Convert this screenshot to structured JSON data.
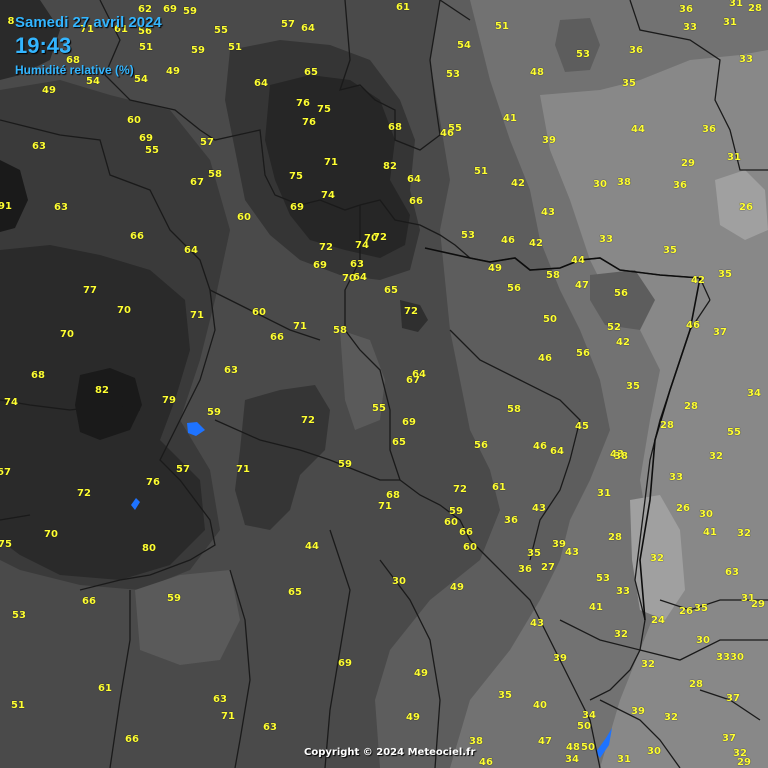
{
  "header": {
    "date": "Samedi 27 avril 2024",
    "time": "19:43",
    "variable": "Humidité relative (%)"
  },
  "copyright": "Copyright © 2024 Meteociel.fr",
  "colors": {
    "value_text": "#ffff33",
    "header_text": "#33b5ff",
    "water": "#1e73ff",
    "borders": "#1a1a1a"
  },
  "humidity_values": [
    "8",
    "62",
    "69",
    "59",
    "61",
    "71",
    "61",
    "56",
    "55",
    "57",
    "64",
    "54",
    "51",
    "36",
    "31",
    "28",
    "33",
    "31",
    "51",
    "59",
    "51",
    "49",
    "53",
    "36",
    "33",
    "68",
    "54",
    "54",
    "49",
    "53",
    "48",
    "65",
    "64",
    "76",
    "75",
    "35",
    "44",
    "60",
    "69",
    "76",
    "68",
    "41",
    "55",
    "46",
    "39",
    "36",
    "63",
    "55",
    "57",
    "82",
    "71",
    "31",
    "29",
    "58",
    "74",
    "64",
    "75",
    "67",
    "51",
    "42",
    "30",
    "38",
    "36",
    "91",
    "63",
    "69",
    "66",
    "26",
    "60",
    "53",
    "66",
    "72",
    "74",
    "70",
    "72",
    "43",
    "46",
    "42",
    "33",
    "35",
    "64",
    "63",
    "69",
    "70",
    "64",
    "44",
    "49",
    "58",
    "65",
    "47",
    "56",
    "42",
    "35",
    "77",
    "70",
    "63",
    "56",
    "60",
    "71",
    "72",
    "50",
    "52",
    "46",
    "37",
    "71",
    "66",
    "58",
    "42",
    "46",
    "70",
    "56",
    "68",
    "64",
    "67",
    "35",
    "82",
    "79",
    "74",
    "55",
    "69",
    "59",
    "58",
    "45",
    "28",
    "34",
    "72",
    "65",
    "56",
    "64",
    "46",
    "28",
    "55",
    "67",
    "71",
    "59",
    "43",
    "38",
    "32",
    "57",
    "76",
    "61",
    "72",
    "33",
    "68",
    "31",
    "72",
    "71",
    "59",
    "36",
    "43",
    "26",
    "30",
    "60",
    "66",
    "60",
    "39",
    "35",
    "43",
    "28",
    "41",
    "32",
    "75",
    "70",
    "80",
    "44",
    "36",
    "27",
    "32",
    "63",
    "30",
    "53",
    "65",
    "49",
    "33",
    "66",
    "31",
    "29",
    "53",
    "41",
    "35",
    "26",
    "24",
    "30",
    "43",
    "32",
    "59",
    "30",
    "33",
    "69",
    "32",
    "39",
    "28",
    "61",
    "49",
    "35",
    "40",
    "37",
    "63",
    "51",
    "71",
    "34",
    "39",
    "32",
    "63",
    "50",
    "49",
    "66",
    "47",
    "37",
    "48",
    "50",
    "30",
    "32",
    "38",
    "34",
    "29",
    "46",
    "31"
  ]
}
